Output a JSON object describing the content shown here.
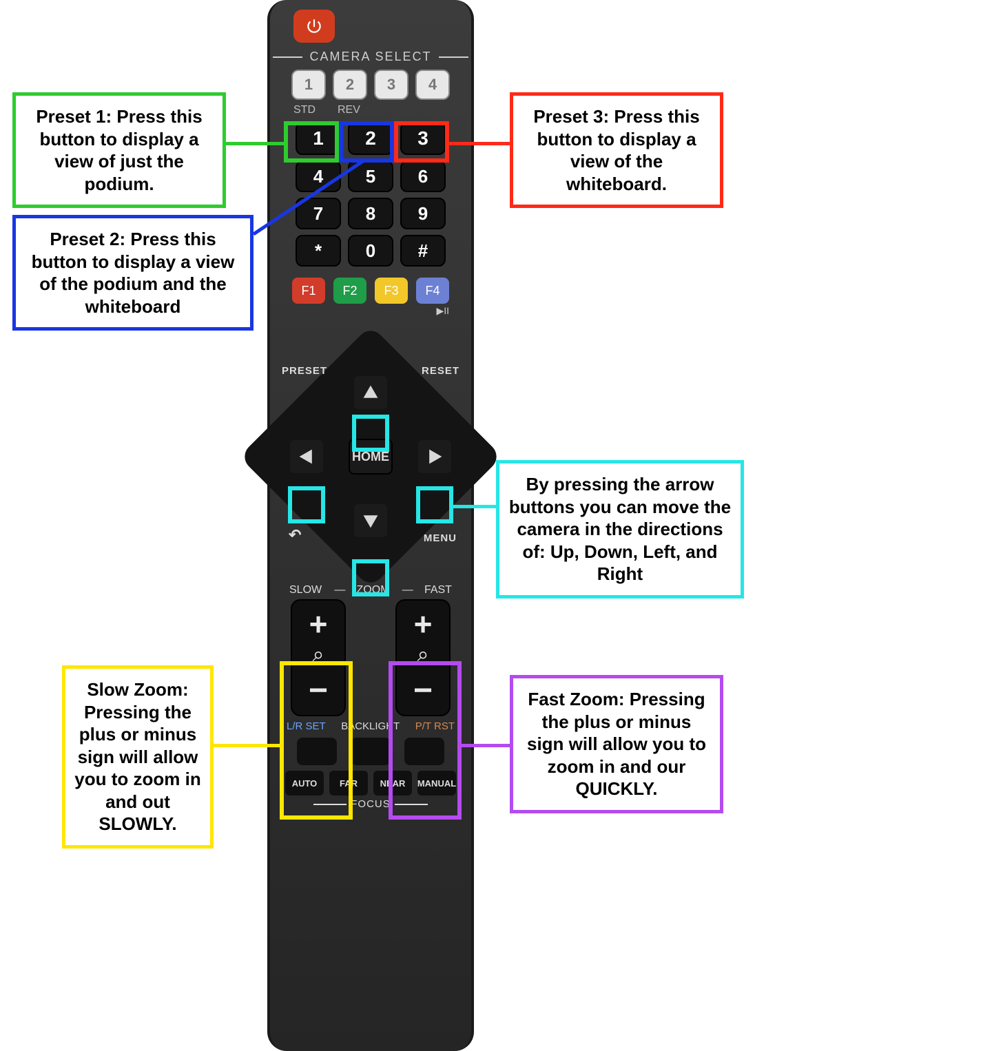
{
  "remote": {
    "camera_select_label": "CAMERA SELECT",
    "cam_buttons": [
      "1",
      "2",
      "3",
      "4"
    ],
    "std_label": "STD",
    "rev_label": "REV",
    "num_row1": [
      "1",
      "2",
      "3"
    ],
    "num_row2": [
      "4",
      "5",
      "6"
    ],
    "num_row3": [
      "7",
      "8",
      "9"
    ],
    "num_row4": [
      "*",
      "0",
      "#"
    ],
    "fkeys": [
      "F1",
      "F2",
      "F3",
      "F4"
    ],
    "play_pause_glyph": "▶II",
    "dpad": {
      "preset": "PRESET",
      "reset": "RESET",
      "home": "HOME",
      "menu": "MENU",
      "back_glyph": "↶"
    },
    "zoom": {
      "slow": "SLOW",
      "mid": "ZOOM",
      "fast": "FAST",
      "plus": "+",
      "minus": "−",
      "magnifier": "⌕"
    },
    "bottom_labels": {
      "lr": "L/R SET",
      "backlight": "BACKLIGHT",
      "ptrst": "P/T RST"
    },
    "focus": {
      "auto": "AUTO",
      "far": "FAR",
      "near": "NEAR",
      "manual": "MANUAL",
      "title": "FOCUS"
    }
  },
  "callouts": {
    "preset1": "Preset 1: Press this button to display a view of just the podium.",
    "preset2": "Preset 2: Press this button to display a view of the podium and the whiteboard",
    "preset3": "Preset 3: Press this button to display a view of the whiteboard.",
    "arrows": "By pressing the arrow buttons you can move the camera in the directions of: Up, Down, Left, and Right",
    "slowzoom": "Slow Zoom: Pressing the plus or minus sign will allow you to zoom in and out SLOWLY.",
    "fastzoom": "Fast Zoom: Pressing the plus or minus sign will allow you to zoom in and our QUICKLY."
  },
  "colors": {
    "green": "#2ecc2e",
    "blue": "#1836e3",
    "red": "#ff2a18",
    "cyan": "#26e6e6",
    "yellow": "#ffe600",
    "purple": "#b44bf0"
  }
}
